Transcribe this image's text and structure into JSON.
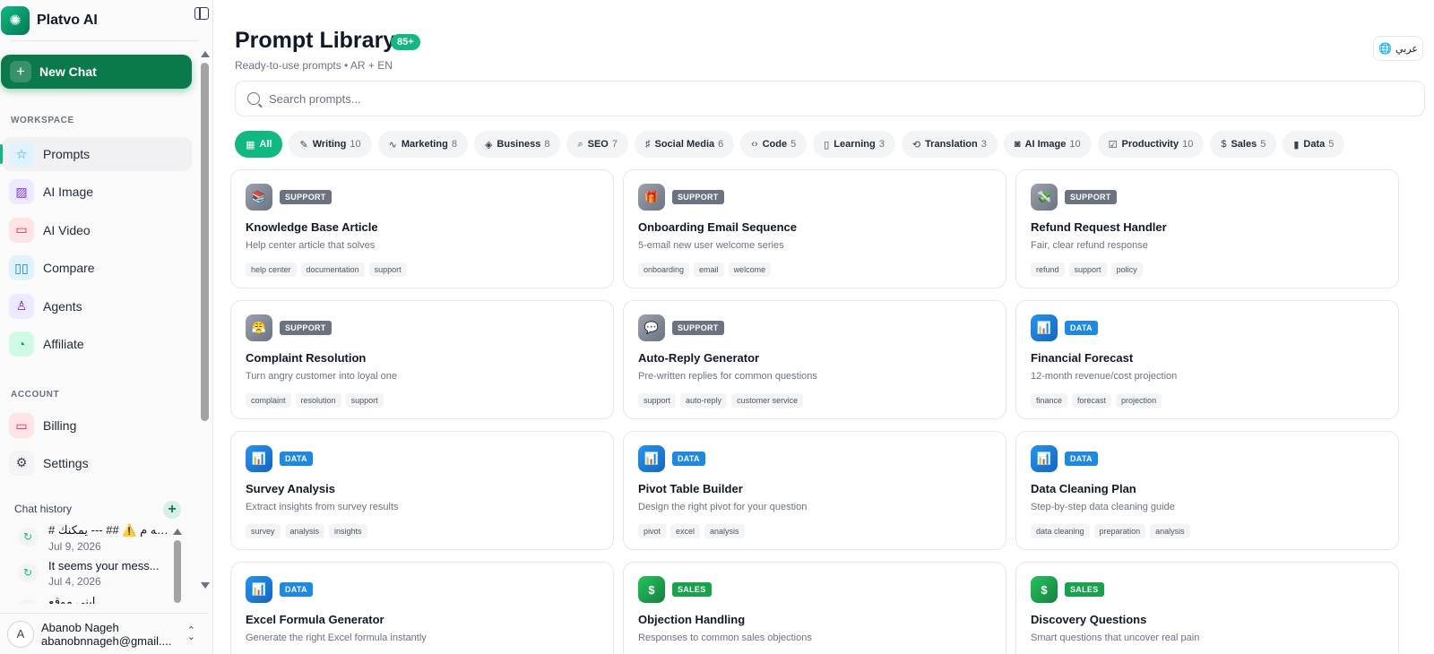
{
  "app": {
    "name": "Platvo AI"
  },
  "sidebar": {
    "new_chat_label": "New Chat",
    "workspace_label": "WORKSPACE",
    "account_label": "ACCOUNT",
    "workspace_items": [
      {
        "label": "Prompts",
        "icon": "star-icon",
        "color": "#0ea5e9",
        "bg": "#e0f2fe"
      },
      {
        "label": "AI Image",
        "icon": "image-icon",
        "color": "#7c3aed",
        "bg": "#ede9fe"
      },
      {
        "label": "AI Video",
        "icon": "video-icon",
        "color": "#e11d48",
        "bg": "#ffe4e6"
      },
      {
        "label": "Compare",
        "icon": "columns-icon",
        "color": "#0284c7",
        "bg": "#e0f2fe"
      },
      {
        "label": "Agents",
        "icon": "user-icon",
        "color": "#6d28d9",
        "bg": "#ede9fe"
      },
      {
        "label": "Affiliate",
        "icon": "clock-icon",
        "color": "#059669",
        "bg": "#d1fae5"
      }
    ],
    "account_items": [
      {
        "label": "Billing",
        "icon": "card-icon",
        "color": "#e11d48",
        "bg": "#ffe4e6"
      },
      {
        "label": "Settings",
        "icon": "settings-icon",
        "color": "#374151",
        "bg": "#f3f4f6"
      }
    ],
    "chat_history_label": "Chat history",
    "chat_history": [
      {
        "title": "# تنبيه م ⚠️ ## --- يمكنك",
        "date": "Jul 9, 2026"
      },
      {
        "title": "It seems your mess...",
        "date": "Jul 4, 2026"
      },
      {
        "title": "ابني موقع",
        "date": ""
      }
    ],
    "user": {
      "avatar_letter": "A",
      "name": "Abanob Nageh",
      "email": "abanobnnageh@gmail...."
    }
  },
  "header": {
    "title": "Prompt Library",
    "badge": "85+",
    "subtitle": "Ready-to-use prompts • AR + EN",
    "lang_button": "عربي"
  },
  "search": {
    "placeholder": "Search prompts..."
  },
  "categories": [
    {
      "label": "All",
      "count": "",
      "icon": "▦",
      "active": true
    },
    {
      "label": "Writing",
      "count": "10",
      "icon": "✎"
    },
    {
      "label": "Marketing",
      "count": "8",
      "icon": "∿"
    },
    {
      "label": "Business",
      "count": "8",
      "icon": "◈"
    },
    {
      "label": "SEO",
      "count": "7",
      "icon": "⌕"
    },
    {
      "label": "Social Media",
      "count": "6",
      "icon": "♯"
    },
    {
      "label": "Code",
      "count": "5",
      "icon": "‹›"
    },
    {
      "label": "Learning",
      "count": "3",
      "icon": "▯"
    },
    {
      "label": "Translation",
      "count": "3",
      "icon": "⟲"
    },
    {
      "label": "AI Image",
      "count": "10",
      "icon": "◙"
    },
    {
      "label": "Productivity",
      "count": "10",
      "icon": "☑"
    },
    {
      "label": "Sales",
      "count": "5",
      "icon": "$"
    },
    {
      "label": "Data",
      "count": "5",
      "icon": "▮"
    }
  ],
  "tag_colors": {
    "SUPPORT": "#6b7280",
    "DATA": "#1e88e5",
    "SALES": "#16a34a"
  },
  "prompts": [
    {
      "tag": "SUPPORT",
      "icon": "📚",
      "title": "Knowledge Base Article",
      "desc": "Help center article that solves",
      "keywords": [
        "help center",
        "documentation",
        "support"
      ]
    },
    {
      "tag": "SUPPORT",
      "icon": "🎁",
      "title": "Onboarding Email Sequence",
      "desc": "5-email new user welcome series",
      "keywords": [
        "onboarding",
        "email",
        "welcome"
      ]
    },
    {
      "tag": "SUPPORT",
      "icon": "💸",
      "title": "Refund Request Handler",
      "desc": "Fair, clear refund response",
      "keywords": [
        "refund",
        "support",
        "policy"
      ]
    },
    {
      "tag": "SUPPORT",
      "icon": "😤",
      "title": "Complaint Resolution",
      "desc": "Turn angry customer into loyal one",
      "keywords": [
        "complaint",
        "resolution",
        "support"
      ]
    },
    {
      "tag": "SUPPORT",
      "icon": "💬",
      "title": "Auto-Reply Generator",
      "desc": "Pre-written replies for common questions",
      "keywords": [
        "support",
        "auto-reply",
        "customer service"
      ]
    },
    {
      "tag": "DATA",
      "icon": "📊",
      "title": "Financial Forecast",
      "desc": "12-month revenue/cost projection",
      "keywords": [
        "finance",
        "forecast",
        "projection"
      ]
    },
    {
      "tag": "DATA",
      "icon": "📊",
      "title": "Survey Analysis",
      "desc": "Extract insights from survey results",
      "keywords": [
        "survey",
        "analysis",
        "insights"
      ]
    },
    {
      "tag": "DATA",
      "icon": "📊",
      "title": "Pivot Table Builder",
      "desc": "Design the right pivot for your question",
      "keywords": [
        "pivot",
        "excel",
        "analysis"
      ]
    },
    {
      "tag": "DATA",
      "icon": "📊",
      "title": "Data Cleaning Plan",
      "desc": "Step-by-step data cleaning guide",
      "keywords": [
        "data cleaning",
        "preparation",
        "analysis"
      ]
    },
    {
      "tag": "DATA",
      "icon": "📊",
      "title": "Excel Formula Generator",
      "desc": "Generate the right Excel formula instantly",
      "keywords": []
    },
    {
      "tag": "SALES",
      "icon": "$",
      "title": "Objection Handling",
      "desc": "Responses to common sales objections",
      "keywords": []
    },
    {
      "tag": "SALES",
      "icon": "$",
      "title": "Discovery Questions",
      "desc": "Smart questions that uncover real pain",
      "keywords": []
    }
  ]
}
